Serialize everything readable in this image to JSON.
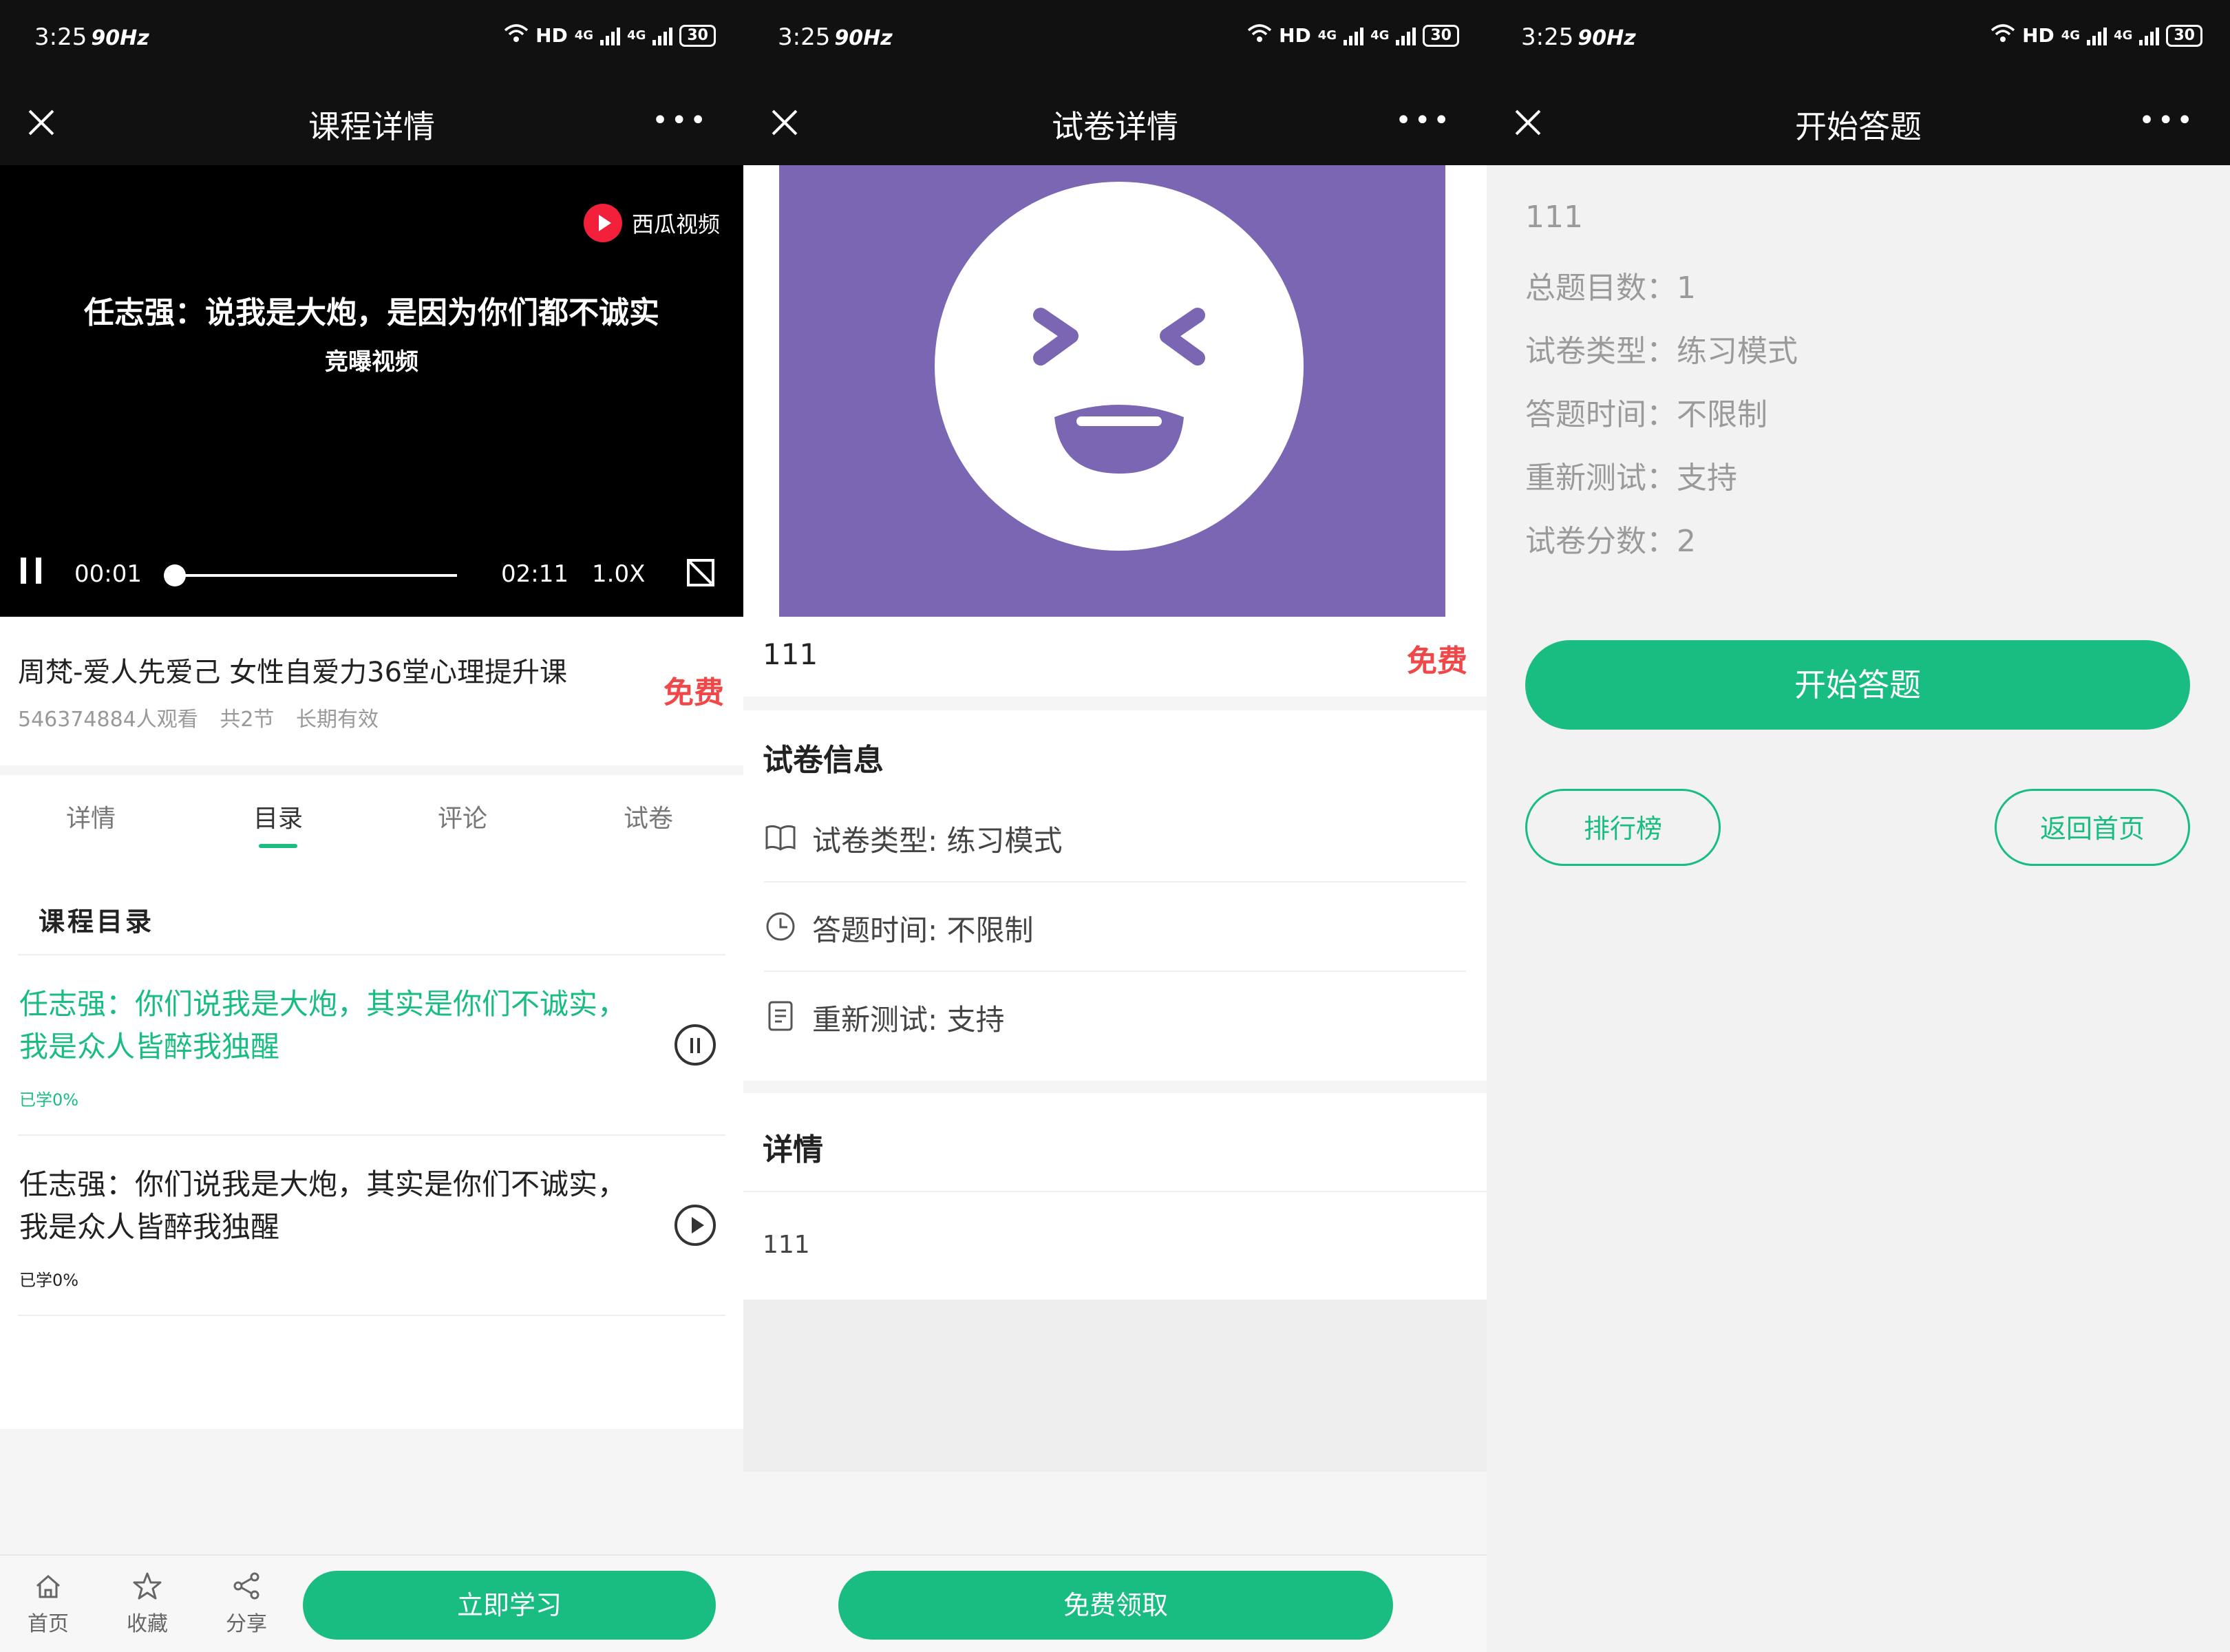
{
  "status": {
    "time": "3:25",
    "hz": "90Hz",
    "network": "HD",
    "net1": "4G",
    "net2": "4G",
    "battery": "30"
  },
  "panel1": {
    "nav_title": "课程详情",
    "video": {
      "brand": "西瓜视频",
      "caption": "任志强：说我是大炮，是因为你们都不诚实",
      "subcaption": "竞曝视频",
      "current_time": "00:01",
      "duration": "02:11",
      "speed": "1.0X",
      "progress": 0.01
    },
    "course": {
      "title": "周梵-爱人先爱己 女性自爱力36堂心理提升课",
      "viewers": "546374884人观看",
      "sections": "共2节",
      "validity": "长期有效",
      "price": "免费"
    },
    "tabs": [
      "详情",
      "目录",
      "评论",
      "试卷"
    ],
    "active_tab": "目录",
    "catalog": {
      "heading": "课程目录",
      "lessons": [
        {
          "title": "任志强：你们说我是大炮，其实是你们不诚实，我是众人皆醉我独醒",
          "progress": "已学0%",
          "state": "playing"
        },
        {
          "title": "任志强：你们说我是大炮，其实是你们不诚实，我是众人皆醉我独醒",
          "progress": "已学0%",
          "state": "paused"
        }
      ]
    },
    "bottom": {
      "home": "首页",
      "fav": "收藏",
      "share": "分享",
      "study": "立即学习"
    }
  },
  "panel2": {
    "nav_title": "试卷详情",
    "name": "111",
    "price": "免费",
    "info_heading": "试卷信息",
    "rows": [
      {
        "label": "试卷类型: 练习模式",
        "icon": "book-icon"
      },
      {
        "label": "答题时间: 不限制",
        "icon": "clock-icon"
      },
      {
        "label": "重新测试: 支持",
        "icon": "document-icon"
      }
    ],
    "detail_heading": "详情",
    "detail_text": "111",
    "claim": "免费领取"
  },
  "panel3": {
    "nav_title": "开始答题",
    "items": [
      "111",
      "总题目数：1",
      "试卷类型：练习模式",
      "答题时间：不限制",
      "重新测试：支持",
      "试卷分数：2"
    ],
    "start": "开始答题",
    "rank": "排行榜",
    "home": "返回首页"
  },
  "colors": {
    "accent": "#19bd81",
    "price": "#f04848",
    "cover": "#7a66b3"
  }
}
